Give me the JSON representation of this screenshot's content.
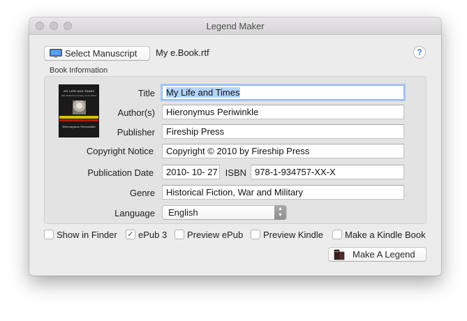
{
  "window": {
    "title": "Legend Maker"
  },
  "toolbar": {
    "select_label": "Select Manuscript",
    "select_icon": "monitor-icon",
    "filename": "My e.Book.rtf",
    "help_label": "?"
  },
  "book_info": {
    "group_label": "Book Information",
    "cover": {
      "title": "MY LIFE AND TIMES",
      "subtitle": "The Hellenic Journey of an Artist",
      "author": "Hieronymus Periwinkle"
    },
    "fields": {
      "title": {
        "label": "Title",
        "value": "My Life and Times"
      },
      "authors": {
        "label": "Author(s)",
        "value": "Hieronymus Periwinkle"
      },
      "publisher": {
        "label": "Publisher",
        "value": "Fireship Press"
      },
      "copyright": {
        "label": "Copyright Notice",
        "value": "Copyright © 2010 by Fireship Press"
      },
      "pub_date": {
        "label": "Publication Date",
        "value": "2010- 10- 27"
      },
      "isbn": {
        "label": "ISBN",
        "value": "978-1-934757-XX-X"
      },
      "genre": {
        "label": "Genre",
        "value": "Historical Fiction, War and Military"
      },
      "language": {
        "label": "Language",
        "value": "English"
      }
    }
  },
  "options": [
    {
      "label": "Show in Finder",
      "checked": false
    },
    {
      "label": "ePub 3",
      "checked": true
    },
    {
      "label": "Preview ePub",
      "checked": false
    },
    {
      "label": "Preview Kindle",
      "checked": false
    },
    {
      "label": "Make a Kindle Book",
      "checked": false
    }
  ],
  "check_mark": "✓",
  "action": {
    "label": "Make A Legend",
    "icon": "book-icon"
  }
}
